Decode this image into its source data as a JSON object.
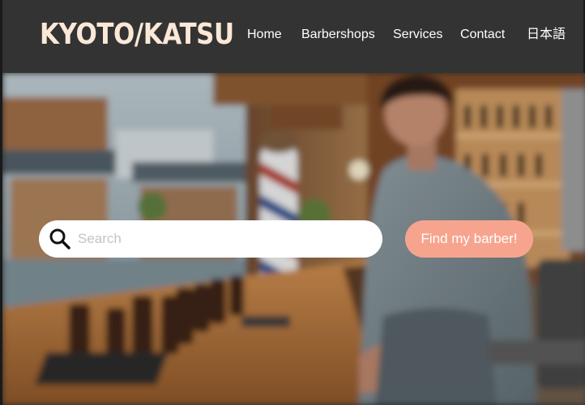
{
  "header": {
    "logo": "KYOTO/KATSU",
    "nav": [
      {
        "label": "Home"
      },
      {
        "label": "Barbershops"
      },
      {
        "label": "Services"
      },
      {
        "label": "Contact"
      },
      {
        "label": "日本語"
      }
    ]
  },
  "hero": {
    "image": "barbershop-interior-photo",
    "search": {
      "placeholder": "Search",
      "value": "",
      "icon": "search-icon"
    },
    "cta_label": "Find my barber!"
  },
  "colors": {
    "header_bg": "#333333",
    "logo": "#fbe8d6",
    "nav_text": "#ffffff",
    "accent": "#f7a48f",
    "search_bg": "#ffffff"
  }
}
